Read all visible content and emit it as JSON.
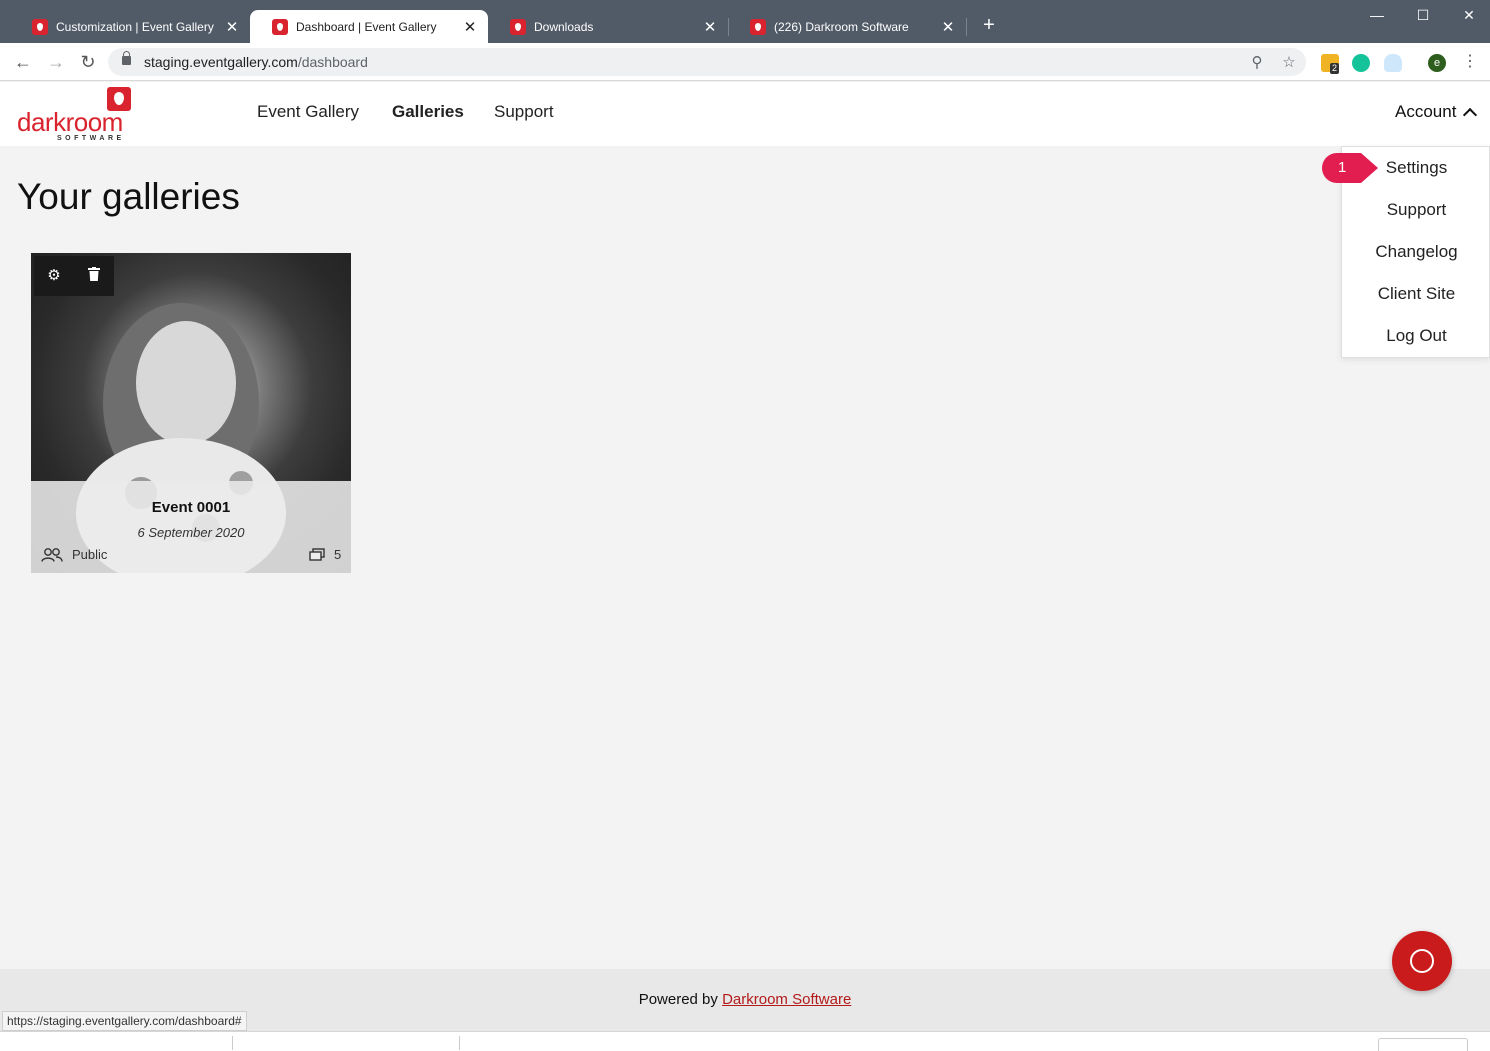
{
  "browser": {
    "tabs": [
      {
        "title": "Customization | Event Gallery",
        "active": false
      },
      {
        "title": "Dashboard | Event Gallery",
        "active": true
      },
      {
        "title": "Downloads",
        "active": false
      },
      {
        "title": "(226) Darkroom Software",
        "active": false
      }
    ],
    "new_tab": "+",
    "url_host": "staging.eventgallery.com",
    "url_path": "/dashboard",
    "extension_badge": "2",
    "profile_initial": "e"
  },
  "site": {
    "logo_text": "darkroom",
    "logo_sub": "SOFTWARE",
    "nav": [
      {
        "label": "Event Gallery",
        "active": false
      },
      {
        "label": "Galleries",
        "active": true
      },
      {
        "label": "Support",
        "active": false
      }
    ],
    "account_label": "Account"
  },
  "account_menu": {
    "items": [
      "Settings",
      "Support",
      "Changelog",
      "Client Site",
      "Log Out"
    ]
  },
  "step_badge": "1",
  "page": {
    "title": "Your galleries"
  },
  "gallery": {
    "name": "Event 0001",
    "date": "6 September 2020",
    "visibility": "Public",
    "photo_count": "5"
  },
  "footer": {
    "powered_prefix": "Powered by",
    "powered_link": "Darkroom Software",
    "status_url": "https://staging.eventgallery.com/dashboard#"
  },
  "colors": {
    "brand_red": "#d9242f",
    "badge_red": "#e21d4f",
    "chat_red": "#c91b1b"
  }
}
